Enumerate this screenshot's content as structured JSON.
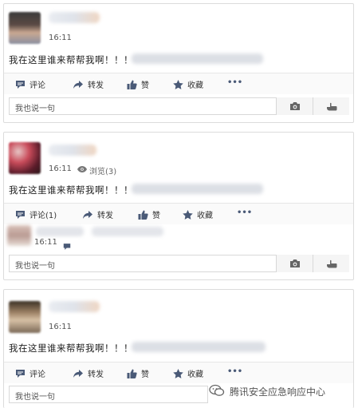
{
  "posts": [
    {
      "time": "16:11",
      "views": "",
      "text": "我在这里谁来帮帮我啊！！！",
      "actions": {
        "comment": "评论",
        "share": "转发",
        "like": "赞",
        "favorite": "收藏",
        "more": "•••"
      },
      "reply": null,
      "comment_placeholder": "我也说一句"
    },
    {
      "time": "16:11",
      "views": "浏览(3)",
      "text": "我在这里谁来帮帮我啊！！！",
      "actions": {
        "comment": "评论(1)",
        "share": "转发",
        "like": "赞",
        "favorite": "收藏",
        "more": "•••"
      },
      "reply": {
        "time": "16:11"
      },
      "comment_placeholder": "我也说一句"
    },
    {
      "time": "16:11",
      "views": "",
      "text": "我在这里谁来帮帮我啊！！！",
      "actions": {
        "comment": "评论",
        "share": "转发",
        "like": "赞",
        "favorite": "收藏",
        "more": "•••"
      },
      "reply": null,
      "comment_placeholder": "我也说一句"
    }
  ],
  "watermark": {
    "text": "腾讯安全应急响应中心",
    "icon": "wechat-icon"
  },
  "colors": {
    "icon": "#4a5a77",
    "border": "#dcdcdc"
  }
}
